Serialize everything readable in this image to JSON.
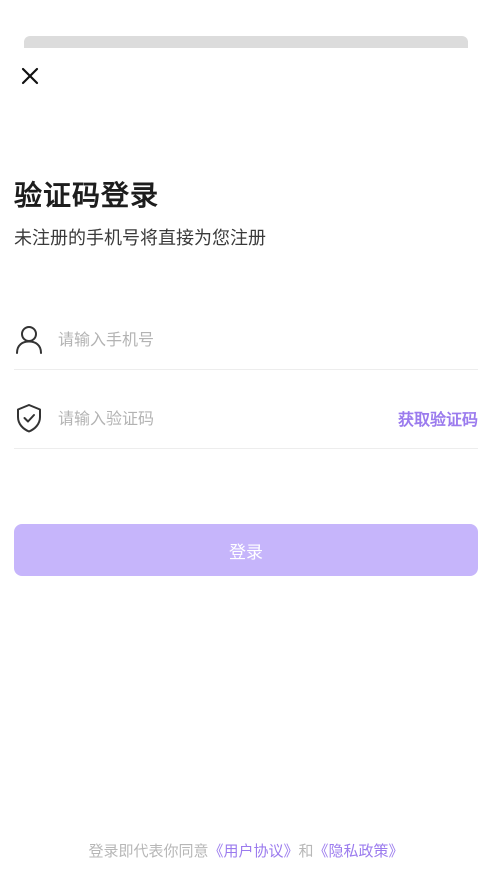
{
  "header": {
    "close_icon": "close-icon"
  },
  "login": {
    "title": "验证码登录",
    "subtitle": "未注册的手机号将直接为您注册"
  },
  "phone_field": {
    "icon": "user-icon",
    "placeholder": "请输入手机号",
    "value": ""
  },
  "code_field": {
    "icon": "shield-check-icon",
    "placeholder": "请输入验证码",
    "value": "",
    "get_code_label": "获取验证码"
  },
  "login_button": {
    "label": "登录"
  },
  "agreement": {
    "prefix": "登录即代表你同意",
    "user_agreement": "《用户协议》",
    "connector": "和",
    "privacy_policy": "《隐私政策》"
  },
  "colors": {
    "accent": "#9b7bee",
    "button_disabled": "#c6b5fb",
    "placeholder": "#b3b3b3"
  }
}
